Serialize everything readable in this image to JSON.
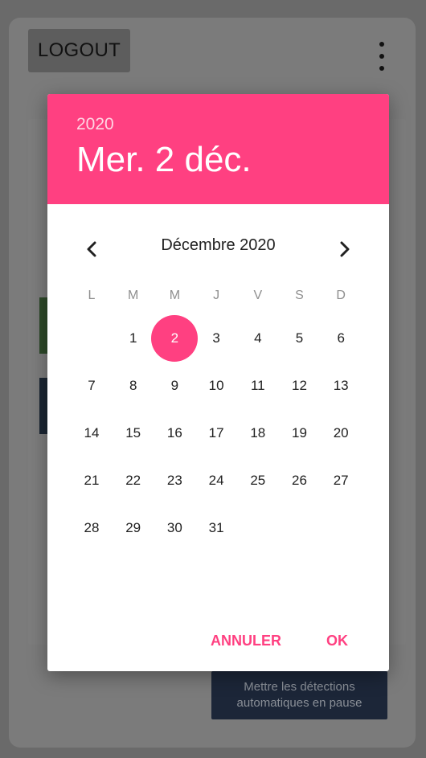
{
  "app": {
    "logout_label": "LOGOUT",
    "pause_button_label": "Mettre les détections automatiques en pause"
  },
  "date_picker": {
    "header": {
      "year": "2020",
      "selected_date": "Mer. 2 déc."
    },
    "month_title": "Décembre 2020",
    "weekdays": [
      "L",
      "M",
      "M",
      "J",
      "V",
      "S",
      "D"
    ],
    "weeks": [
      [
        "",
        "1",
        "2",
        "3",
        "4",
        "5",
        "6"
      ],
      [
        "7",
        "8",
        "9",
        "10",
        "11",
        "12",
        "13"
      ],
      [
        "14",
        "15",
        "16",
        "17",
        "18",
        "19",
        "20"
      ],
      [
        "21",
        "22",
        "23",
        "24",
        "25",
        "26",
        "27"
      ],
      [
        "28",
        "29",
        "30",
        "31",
        "",
        "",
        ""
      ]
    ],
    "selected_day": "2",
    "cancel_label": "ANNULER",
    "ok_label": "OK"
  },
  "colors": {
    "accent": "#ff4081",
    "scrim": "#6a6a6a"
  },
  "icons": {
    "prev": "chevron-left-icon",
    "next": "chevron-right-icon",
    "menu": "more-vertical-icon"
  }
}
